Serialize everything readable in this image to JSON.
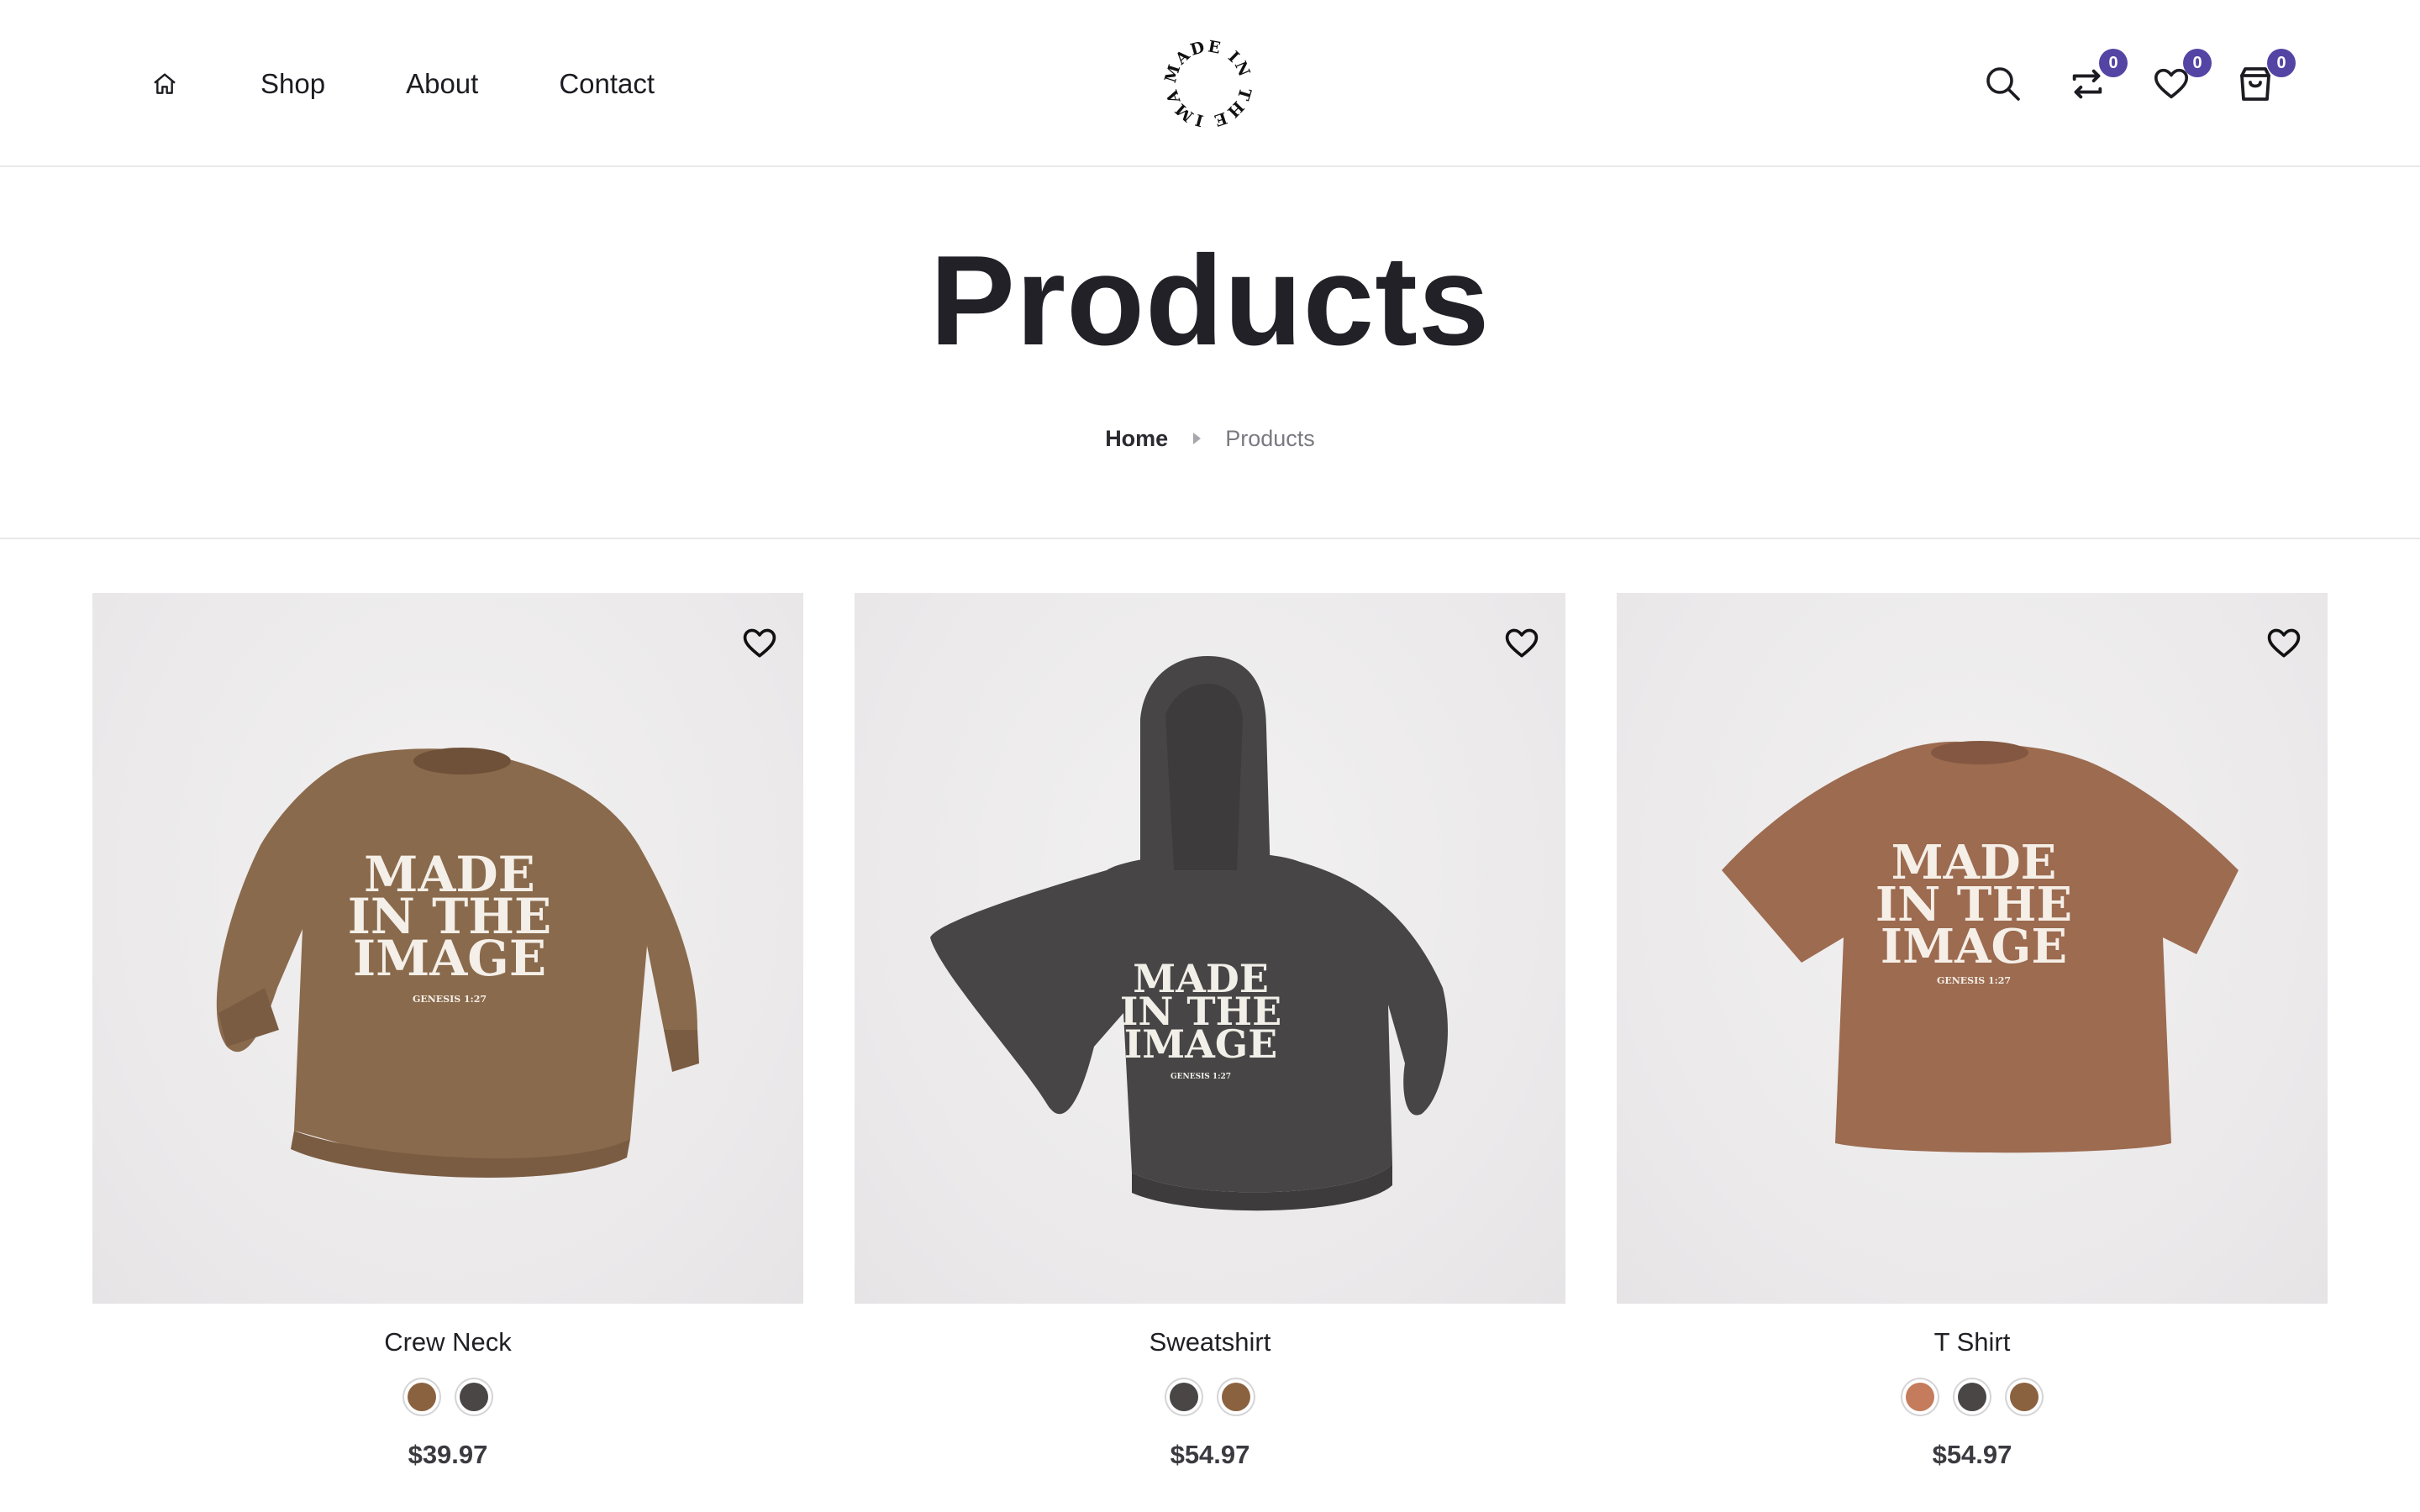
{
  "nav": {
    "home_icon": "home-icon",
    "links": [
      "Shop",
      "About",
      "Contact"
    ]
  },
  "logo": {
    "text": "MADE IN THE IMAGE"
  },
  "actions": {
    "compare_count": "0",
    "wishlist_count": "0",
    "cart_count": "0",
    "accent": "#5444a4"
  },
  "page": {
    "title": "Products"
  },
  "breadcrumb": {
    "home": "Home",
    "current": "Products"
  },
  "products": [
    {
      "name": "Crew Neck",
      "price": "$39.97",
      "garment_color": "#8a6a4c",
      "print_text": [
        "MADE",
        "IN THE",
        "IMAGE"
      ],
      "print_small": "GENESIS 1:27",
      "swatches": [
        "#8b6240",
        "#4a4646"
      ]
    },
    {
      "name": "Sweatshirt",
      "price": "$54.97",
      "garment_color": "#474545",
      "print_text": [
        "MADE",
        "IN THE",
        "IMAGE"
      ],
      "print_small": "GENESIS 1:27",
      "swatches": [
        "#4a4646",
        "#8b6240"
      ]
    },
    {
      "name": "T Shirt",
      "price": "$54.97",
      "garment_color": "#9c6b50",
      "print_text": [
        "MADE",
        "IN THE",
        "IMAGE"
      ],
      "print_small": "GENESIS 1:27",
      "swatches": [
        "#c47c5c",
        "#4a4646",
        "#8b6240"
      ]
    }
  ]
}
